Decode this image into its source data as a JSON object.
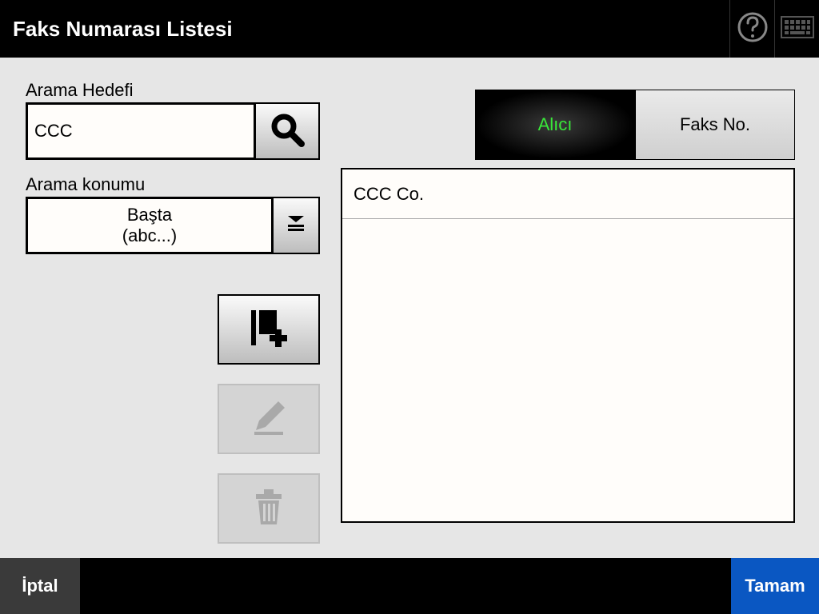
{
  "header": {
    "title": "Faks Numarası Listesi"
  },
  "search": {
    "label": "Arama Hedefi",
    "value": "CCC"
  },
  "location": {
    "label": "Arama konumu",
    "value_line1": "Başta",
    "value_line2": "(abc...)"
  },
  "tabs": {
    "recipient": "Alıcı",
    "faxno": "Faks No."
  },
  "list": {
    "items": [
      "CCC Co."
    ]
  },
  "footer": {
    "cancel": "İptal",
    "ok": "Tamam"
  }
}
